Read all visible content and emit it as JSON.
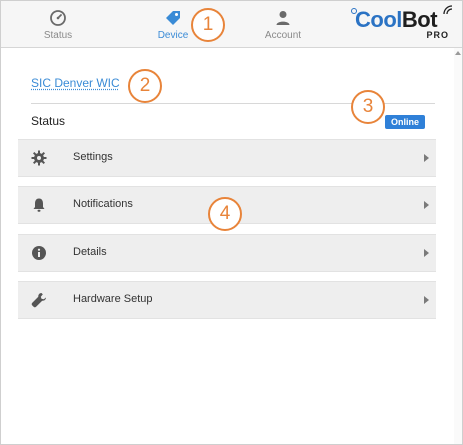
{
  "nav": {
    "status_label": "Status",
    "device_label": "Device",
    "account_label": "Account",
    "active": "device"
  },
  "logo": {
    "cool": "Cool",
    "bot": "Bot",
    "sub": "PRO"
  },
  "device": {
    "name": "SIC Denver WIC"
  },
  "status": {
    "label": "Status",
    "badge": "Online"
  },
  "menu": {
    "items": [
      {
        "label": "Settings",
        "icon": "gear-icon"
      },
      {
        "label": "Notifications",
        "icon": "bell-icon"
      },
      {
        "label": "Details",
        "icon": "info-icon"
      },
      {
        "label": "Hardware Setup",
        "icon": "wrench-icon"
      }
    ]
  },
  "callouts": [
    "1",
    "2",
    "3",
    "4"
  ],
  "colors": {
    "accent": "#3a8bd6",
    "badge": "#2f80d8",
    "callout": "#e8843a",
    "row_bg": "#eeeeee"
  }
}
